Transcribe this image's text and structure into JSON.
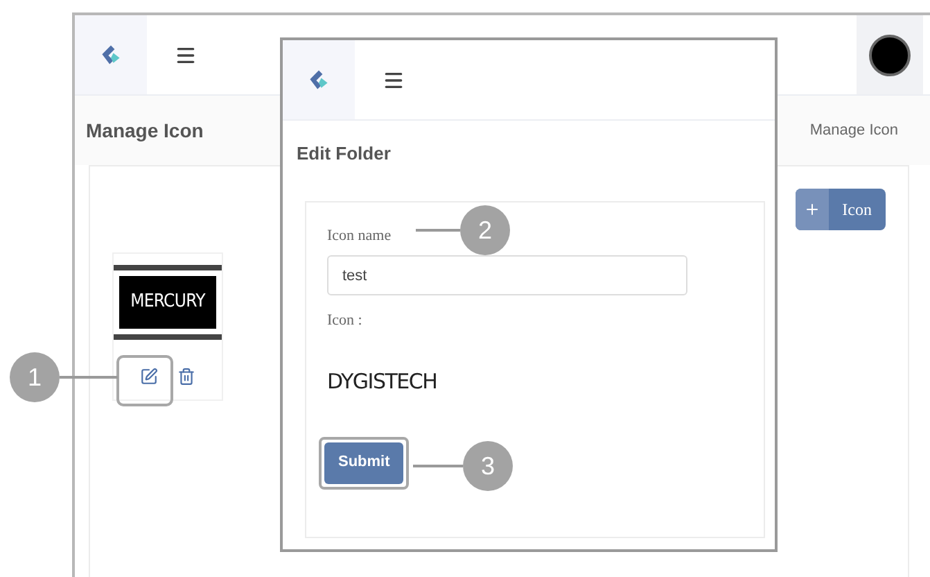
{
  "app": {
    "page_title": "Manage Icon",
    "breadcrumb": "Manage Icon",
    "add_button": {
      "label": "Icon"
    },
    "icons": [
      {
        "logo_text": "MERCURY"
      }
    ]
  },
  "dialog": {
    "title": "Edit Folder",
    "name_label": "Icon name",
    "name_value": "test",
    "icon_label": "Icon :",
    "icon_logo_text": "DYGISTECH",
    "submit": "Submit"
  },
  "callouts": [
    {
      "number": "1"
    },
    {
      "number": "2"
    },
    {
      "number": "3"
    }
  ]
}
